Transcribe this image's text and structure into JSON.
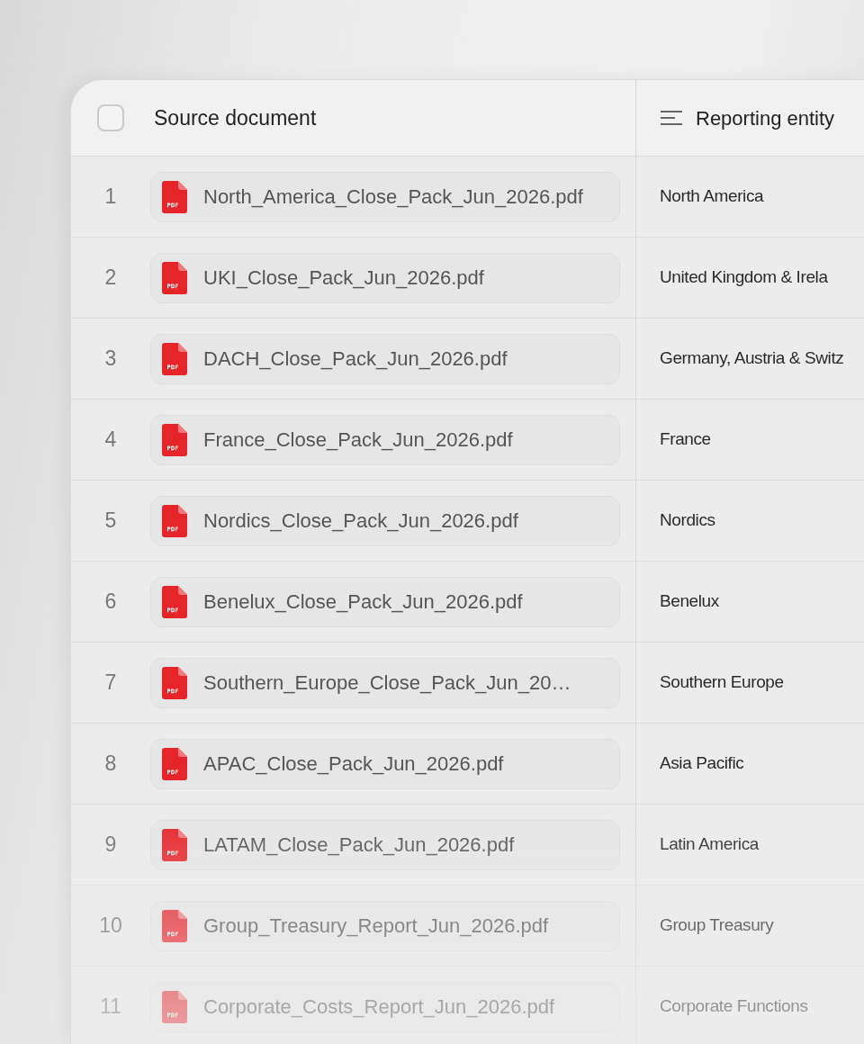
{
  "table": {
    "select_all": {
      "checked": false
    },
    "columns": [
      "Source document",
      "Reporting entity"
    ],
    "rows": [
      {
        "number": "1",
        "file": "North_America_Close_Pack_Jun_2026.pdf",
        "entity": "North America"
      },
      {
        "number": "2",
        "file": "UKI_Close_Pack_Jun_2026.pdf",
        "entity": "United Kingdom & Irela"
      },
      {
        "number": "3",
        "file": "DACH_Close_Pack_Jun_2026.pdf",
        "entity": "Germany, Austria & Switz"
      },
      {
        "number": "4",
        "file": "France_Close_Pack_Jun_2026.pdf",
        "entity": "France"
      },
      {
        "number": "5",
        "file": "Nordics_Close_Pack_Jun_2026.pdf",
        "entity": "Nordics"
      },
      {
        "number": "6",
        "file": "Benelux_Close_Pack_Jun_2026.pdf",
        "entity": "Benelux"
      },
      {
        "number": "7",
        "file": "Southern_Europe_Close_Pack_Jun_20…",
        "entity": "Southern Europe"
      },
      {
        "number": "8",
        "file": "APAC_Close_Pack_Jun_2026.pdf",
        "entity": "Asia Pacific"
      },
      {
        "number": "9",
        "file": "LATAM_Close_Pack_Jun_2026.pdf",
        "entity": "Latin America"
      },
      {
        "number": "10",
        "file": "Group_Treasury_Report_Jun_2026.pdf",
        "entity": "Group Treasury"
      },
      {
        "number": "11",
        "file": "Corporate_Costs_Report_Jun_2026.pdf",
        "entity": "Corporate Functions"
      }
    ]
  }
}
